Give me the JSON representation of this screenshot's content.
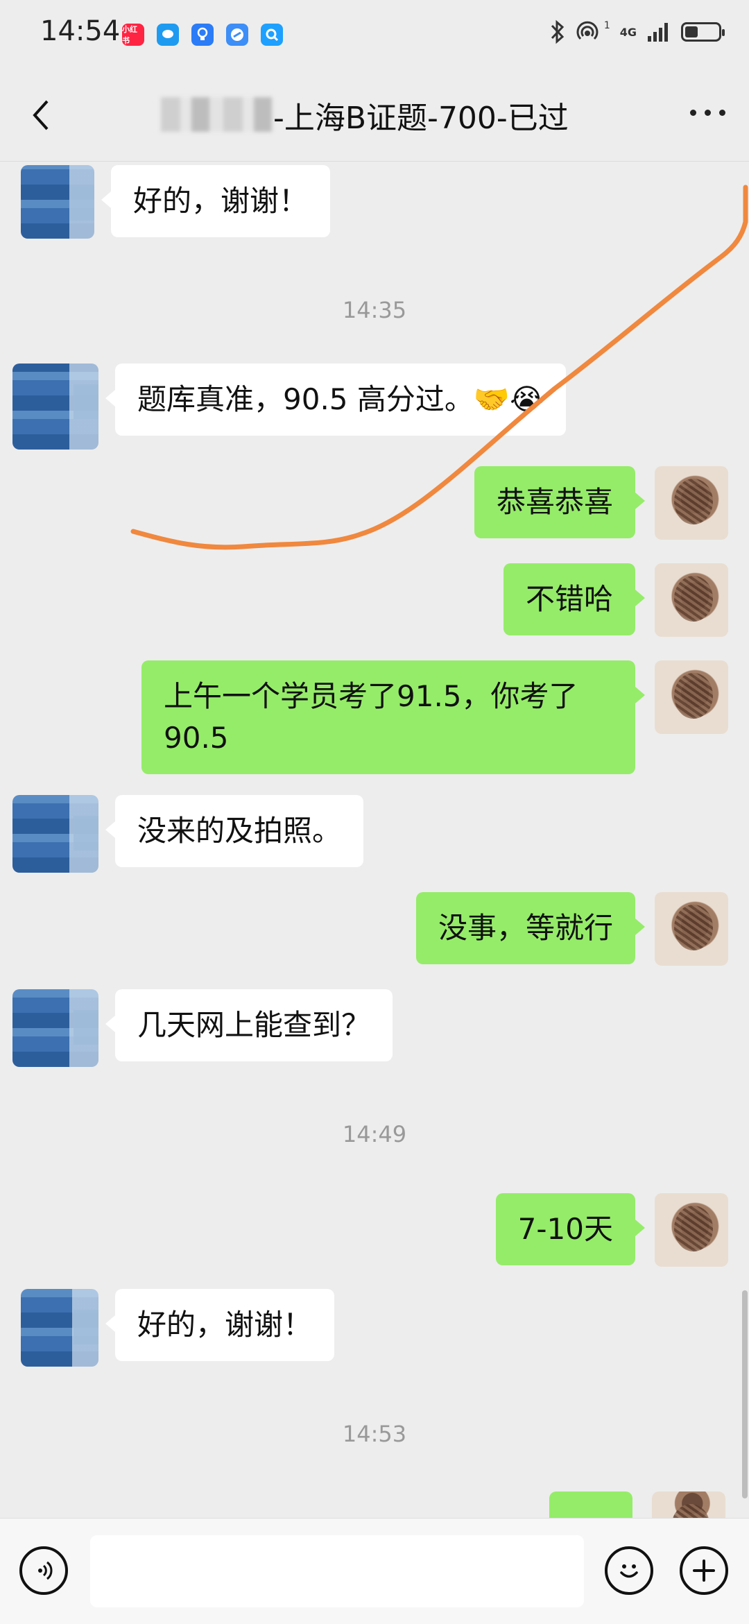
{
  "status": {
    "time": "14:54",
    "network": "4G",
    "sim_index": "1",
    "apps": [
      {
        "icon": "xiaohongshu-icon",
        "label": "小红书",
        "color": "#ff2442"
      },
      {
        "icon": "message-icon",
        "label": "",
        "color": "#1e9bf0"
      },
      {
        "icon": "idea-icon",
        "label": "",
        "color": "#2b7cf6"
      },
      {
        "icon": "browser-icon",
        "label": "",
        "color": "#3d8ef7"
      },
      {
        "icon": "search-icon",
        "label": "",
        "color": "#1ea0ff"
      }
    ],
    "battery_level": 0.34
  },
  "header": {
    "title": "-上海B证题-700-已过"
  },
  "messages": [
    {
      "side": "in",
      "text": "好的，谢谢！"
    },
    {
      "type": "time",
      "text": "14:35"
    },
    {
      "side": "in",
      "text": "题库真准，90.5 高分过。🤝😭"
    },
    {
      "side": "out",
      "text": "恭喜恭喜"
    },
    {
      "side": "out",
      "text": "不错哈"
    },
    {
      "side": "out",
      "text": "上午一个学员考了91.5，你考了90.5"
    },
    {
      "side": "in",
      "text": "没来的及拍照。"
    },
    {
      "side": "out",
      "text": "没事，等就行"
    },
    {
      "side": "in",
      "text": "几天网上能查到？"
    },
    {
      "type": "time",
      "text": "14:49"
    },
    {
      "side": "out",
      "text": "7-10天"
    },
    {
      "side": "in",
      "text": "好的，谢谢！"
    },
    {
      "type": "time",
      "text": "14:53"
    }
  ],
  "colors": {
    "background": "#ededed",
    "bubble_out": "#95ec69",
    "bubble_in": "#ffffff",
    "annotation_stroke": "#f0883e"
  }
}
